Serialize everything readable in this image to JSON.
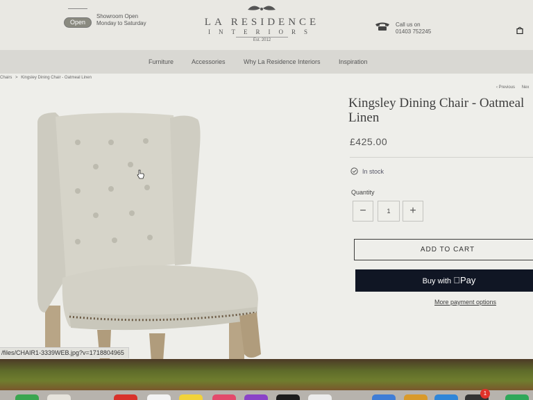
{
  "header": {
    "open_badge": "Open",
    "showroom_line1": "Showroom Open",
    "showroom_line2": "Monday to Saturday",
    "logo_title": "LA RESIDENCE",
    "logo_subtitle": "INTERIORS",
    "logo_est": "Est. 2012",
    "call_label": "Call us on",
    "phone": "01403 752245"
  },
  "nav": {
    "items": [
      "Furniture",
      "Accessories",
      "Why La Residence Interiors",
      "Inspiration"
    ]
  },
  "breadcrumb": {
    "parent": "Chairs",
    "separator": ">",
    "current": "Kingsley Dining Chair - Oatmeal Linen"
  },
  "pager": {
    "previous": "‹ Previous",
    "next": "Nex"
  },
  "product": {
    "title": "Kingsley Dining Chair - Oatmeal Linen",
    "price": "£425.00",
    "stock": "In stock",
    "quantity_label": "Quantity",
    "quantity_value": "1",
    "minus": "−",
    "plus": "+",
    "add_to_cart": "ADD TO CART",
    "buy_with": "Buy with",
    "pay_brand": "Pay",
    "more_payment": "More payment options"
  },
  "status_bar": {
    "url": "/files/CHAIR1-3339WEB.jpg?v=1718804965"
  },
  "dock": {
    "badge_count": "1"
  },
  "colors": {
    "accent_dark": "#101624",
    "page_bg": "#eeeeea",
    "upholstery": "#d6d4c9"
  }
}
